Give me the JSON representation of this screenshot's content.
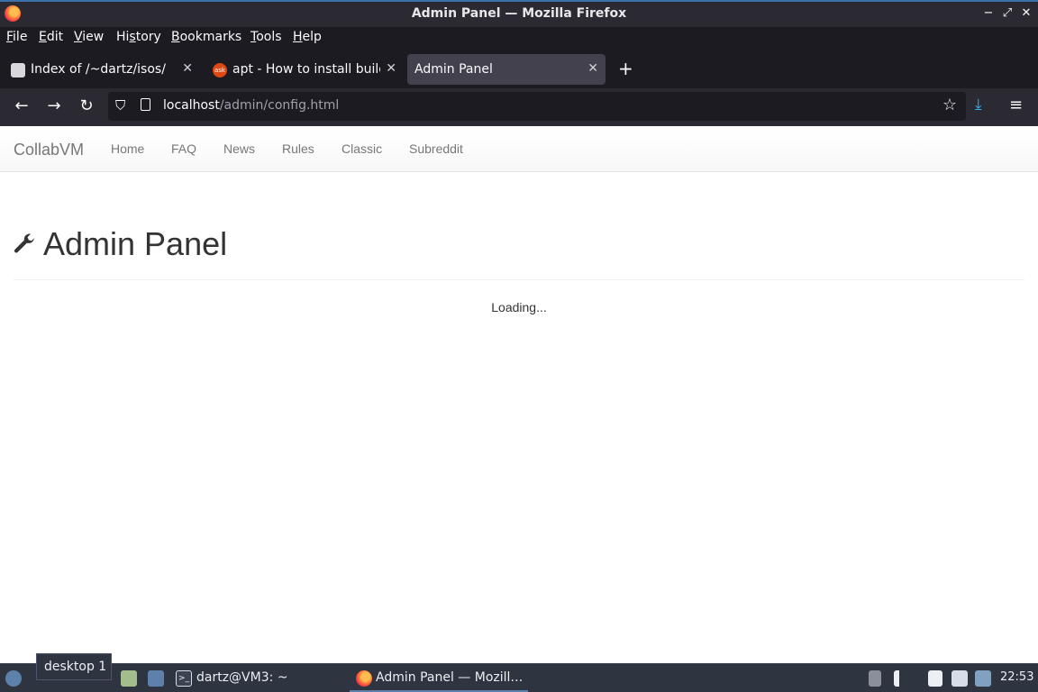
{
  "window": {
    "title": "Admin Panel — Mozilla Firefox",
    "minimize": "−",
    "maximize": "⤢",
    "close": "✕"
  },
  "menu": {
    "file": {
      "u": "F",
      "rest": "ile"
    },
    "edit": {
      "u": "E",
      "rest": "dit"
    },
    "view": {
      "u": "V",
      "rest": "iew"
    },
    "history": {
      "pre": "Hi",
      "u": "s",
      "rest": "tory"
    },
    "bookmarks": {
      "u": "B",
      "rest": "ookmarks"
    },
    "tools": {
      "u": "T",
      "rest": "ools"
    },
    "help": {
      "u": "H",
      "rest": "elp"
    }
  },
  "tabs": [
    {
      "label": "Index of /~dartz/isos/",
      "close": "✕"
    },
    {
      "label": "apt - How to install build-",
      "close": "✕",
      "favicon_text": "ask"
    },
    {
      "label": "Admin Panel",
      "close": "✕"
    }
  ],
  "newtab": "+",
  "nav": {
    "back": "←",
    "forward": "→",
    "reload": "↻",
    "shield": "⛉",
    "star": "☆",
    "download": "⤓",
    "menu": "≡"
  },
  "url": {
    "host": "localhost",
    "path": "/admin/config.html"
  },
  "site": {
    "brand": "CollabVM",
    "links": [
      "Home",
      "FAQ",
      "News",
      "Rules",
      "Classic",
      "Subreddit"
    ],
    "heading": "Admin Panel",
    "status": "Loading..."
  },
  "taskbar": {
    "tooltip": "desktop 1",
    "terminal": "dartz@VM3: ~",
    "firefox": "Admin Panel — Mozill…",
    "terminal_glyph": ">_",
    "clock": "22:53"
  },
  "colors": {
    "accent": "#29b5ef",
    "tab_active": "#42414d",
    "chrome": "#2b2a33"
  }
}
